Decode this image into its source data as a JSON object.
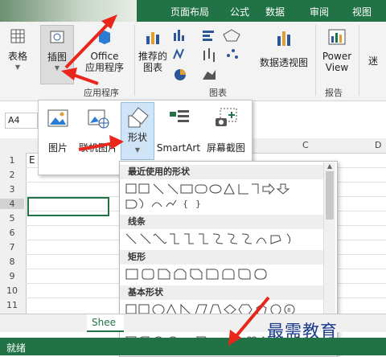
{
  "ribbon_tabs": [
    "页面布局",
    "公式",
    "数据",
    "审阅",
    "视图"
  ],
  "ribbon": {
    "table_label": "表格",
    "illustrations_label": "插图",
    "office_apps_line1": "Office",
    "office_apps_line2": "应用程序",
    "recommended_charts_line1": "推荐的",
    "recommended_charts_line2": "图表",
    "pivot_chart_label": "数据透视图",
    "power_view_line1": "Power",
    "power_view_line2": "View",
    "partial_label": "迷",
    "group_apps": "应用程序",
    "group_charts": "图表",
    "group_reports": "报告"
  },
  "namebox": "A4",
  "column_headers": [
    "C",
    "D"
  ],
  "row_numbers": [
    "1",
    "2",
    "3",
    "4",
    "5",
    "6",
    "7",
    "8",
    "9",
    "10",
    "11"
  ],
  "cell_a1_partial": "E",
  "illustrations_menu": {
    "picture": "图片",
    "online_picture": "联机图片",
    "shapes": "形状",
    "smartart": "SmartArt",
    "screenshot": "屏幕截图"
  },
  "shapes_gallery": {
    "recent": "最近使用的形状",
    "lines": "线条",
    "rectangles": "矩形",
    "basic": "基本形状"
  },
  "sheet_tab": "Shee",
  "status": "就绪",
  "watermark": "最需教育",
  "colors": {
    "excel_green": "#217346",
    "arrow_red": "#e8261c",
    "accent_blue": "#2b579a"
  }
}
